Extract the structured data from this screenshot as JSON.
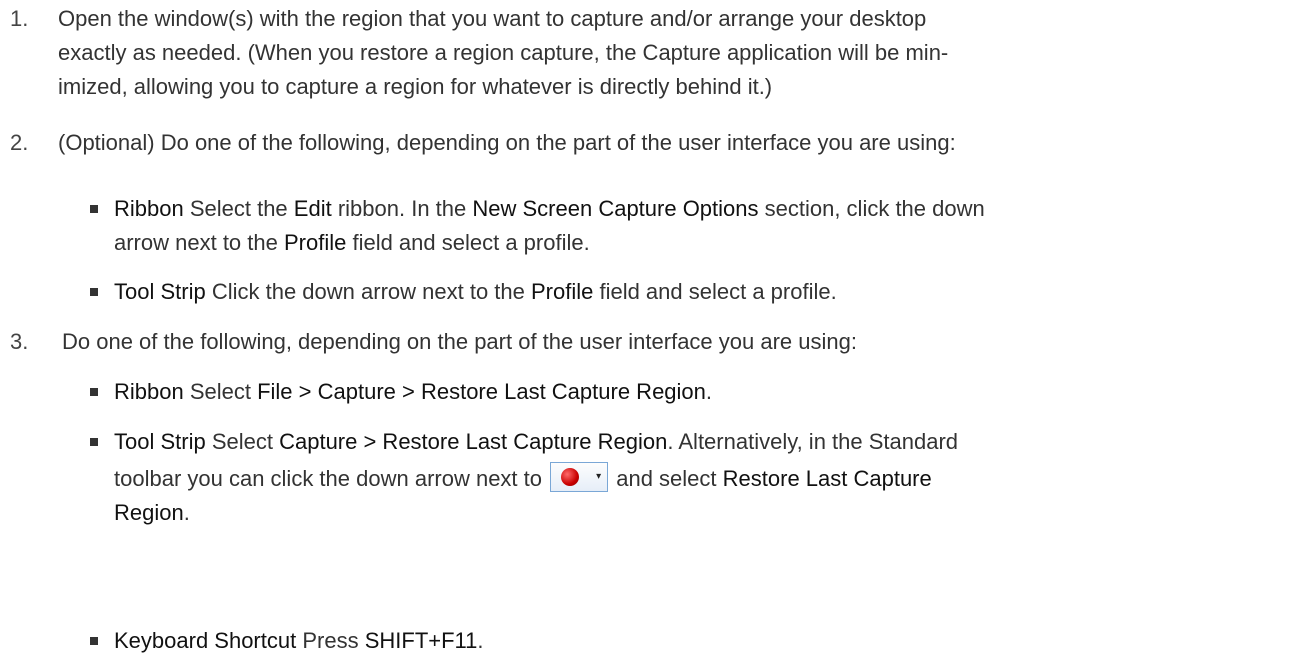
{
  "steps": [
    {
      "number": "1.",
      "text": "Open the window(s) with the region that you want to capture and/or arrange your desktop exactly as needed. (When you restore a region capture, the Capture application will be min-imized, allowing you to capture a region for whatever is directly behind it.)",
      "lines": [
        "Open the window(s) with the region that you want to capture and/or arrange your desktop",
        "exactly as needed. (When you restore a region capture, the Capture application will be min-",
        "imized, allowing you to capture a region for whatever is directly behind it.)"
      ]
    },
    {
      "number": "2.",
      "text": "(Optional) Do one of the following, depending on the part of the user interface you are using:",
      "bullets": [
        {
          "label": "Ribbon",
          "t1": " Select the ",
          "b1": "Edit",
          "t2": " ribbon. In the ",
          "b2": "New Screen Capture Options",
          "t3": " section, click the down",
          "t4": "arrow next to the ",
          "b3": "Profile",
          "t5": " field and select a profile."
        },
        {
          "label": "Tool Strip",
          "t1": " Click the down arrow next to the ",
          "b1": "Profile",
          "t2": " field and select a profile."
        }
      ]
    },
    {
      "number": "3.",
      "text": "Do one of the following, depending on the part of the user interface you are using:",
      "bullets": [
        {
          "label": "Ribbon",
          "t1": " Select ",
          "b1": "File > Capture > Restore Last Capture Region",
          "t2": "."
        },
        {
          "label": "Tool Strip",
          "t1": " Select ",
          "b1": "Capture > Restore Last Capture Region",
          "t2": ". Alternatively, in the Standard",
          "t3": "toolbar you can click the down arrow next to ",
          "t4": " and select ",
          "b2": "Restore Last Capture",
          "b3": "Region",
          "t5": "."
        },
        {
          "label": "Keyboard Shortcut",
          "t1": " Press ",
          "b1": "SHIFT+F11",
          "t2": "."
        }
      ]
    }
  ],
  "icons": {
    "capture_button": "capture-record-icon",
    "capture_dot_color": "#cc0000"
  }
}
